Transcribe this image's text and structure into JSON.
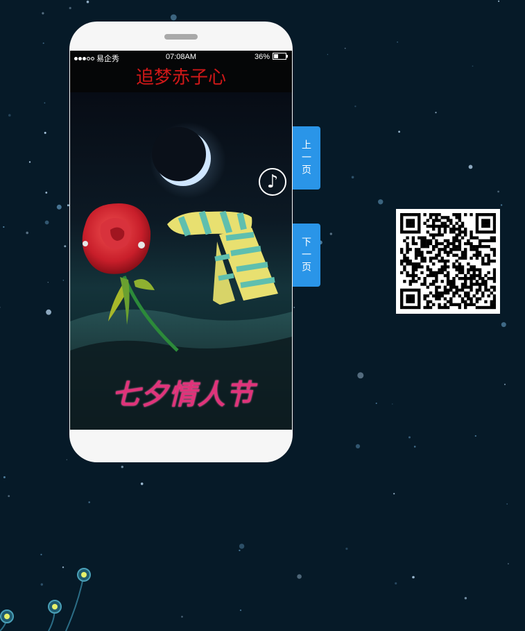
{
  "status_bar": {
    "carrier": "易企秀",
    "time": "07:08AM",
    "battery": "36%",
    "battery_level": 0.36,
    "signal_bars_filled": 3,
    "signal_bars_total": 5
  },
  "page": {
    "title": "追梦赤子心",
    "festival_logo": "七夕情人节"
  },
  "music": {
    "icon": "music-note-icon",
    "glyph": "♪"
  },
  "nav": {
    "prev_label": "上一页",
    "next_label": "下一页"
  },
  "qr_code": {
    "icon": "qr-code-icon"
  },
  "colors": {
    "background": "#061a28",
    "title": "#d01818",
    "nav_button": "#2a95e8",
    "logo": "#e0337a"
  }
}
